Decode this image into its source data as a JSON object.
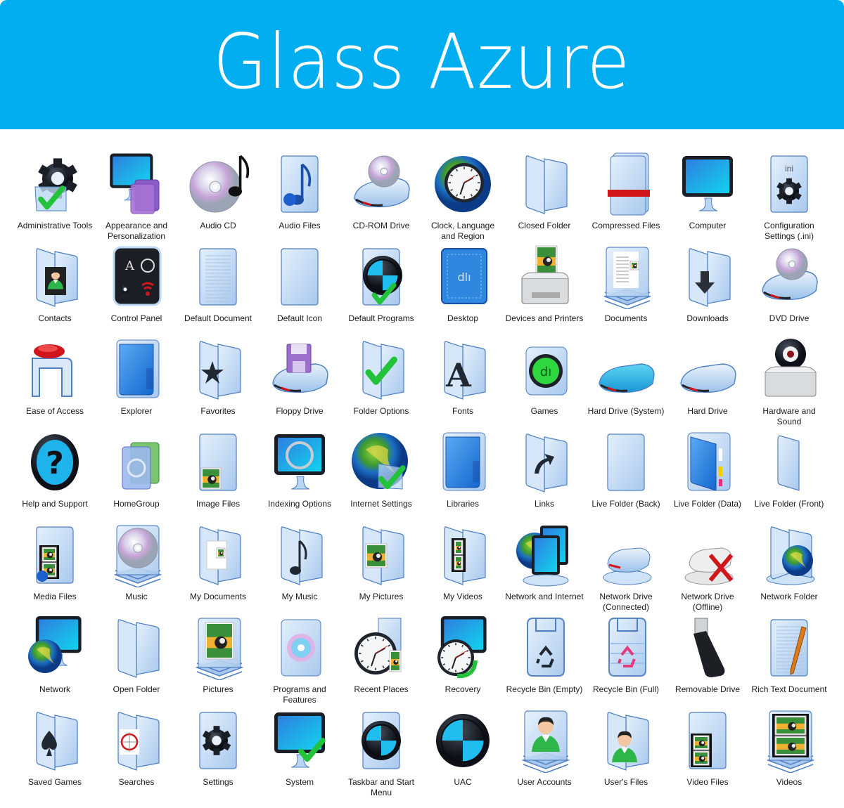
{
  "title": "Glass Azure",
  "colors": {
    "banner": "#00adef",
    "banner_text": "#ffffff",
    "glass": "#bcd8f4",
    "glass_edge": "#4d7fc4",
    "accent_blue": "#1fa3e6",
    "check_green": "#22c33a",
    "red": "#d0161b"
  },
  "icons": [
    {
      "label": "Administrative Tools",
      "kind": "gear-check"
    },
    {
      "label": "Appearance and Personalization",
      "kind": "monitor-palette"
    },
    {
      "label": "Audio CD",
      "kind": "cd-note"
    },
    {
      "label": "Audio Files",
      "kind": "doc-note"
    },
    {
      "label": "CD-ROM Drive",
      "kind": "drive-cd"
    },
    {
      "label": "Clock, Language and Region",
      "kind": "globe-clock"
    },
    {
      "label": "Closed Folder",
      "kind": "folder"
    },
    {
      "label": "Compressed Files",
      "kind": "zip"
    },
    {
      "label": "Computer",
      "kind": "monitor"
    },
    {
      "label": "Configuration Settings (.ini)",
      "kind": "doc-gear"
    },
    {
      "label": "Contacts",
      "kind": "folder-user"
    },
    {
      "label": "Control Panel",
      "kind": "control-panel"
    },
    {
      "label": "Default Document",
      "kind": "doc-lines"
    },
    {
      "label": "Default Icon",
      "kind": "doc"
    },
    {
      "label": "Default Programs",
      "kind": "doc-disc-check"
    },
    {
      "label": "Desktop",
      "kind": "desktop"
    },
    {
      "label": "Devices and Printers",
      "kind": "printer"
    },
    {
      "label": "Documents",
      "kind": "stack-doc"
    },
    {
      "label": "Downloads",
      "kind": "folder-arrow"
    },
    {
      "label": "DVD Drive",
      "kind": "drive-cd"
    },
    {
      "label": "Ease of Access",
      "kind": "ease"
    },
    {
      "label": "Explorer",
      "kind": "explorer"
    },
    {
      "label": "Favorites",
      "kind": "folder-star"
    },
    {
      "label": "Floppy Drive",
      "kind": "drive-floppy"
    },
    {
      "label": "Folder Options",
      "kind": "folder-check"
    },
    {
      "label": "Fonts",
      "kind": "folder-font"
    },
    {
      "label": "Games",
      "kind": "games"
    },
    {
      "label": "Hard Drive (System)",
      "kind": "hdd-system"
    },
    {
      "label": "Hard Drive",
      "kind": "hdd"
    },
    {
      "label": "Hardware and Sound",
      "kind": "speaker"
    },
    {
      "label": "Help and Support",
      "kind": "help"
    },
    {
      "label": "HomeGroup",
      "kind": "homegroup"
    },
    {
      "label": "Image Files",
      "kind": "doc-image"
    },
    {
      "label": "Indexing Options",
      "kind": "monitor-search"
    },
    {
      "label": "Internet Settings",
      "kind": "globe-check"
    },
    {
      "label": "Libraries",
      "kind": "explorer"
    },
    {
      "label": "Links",
      "kind": "folder-link"
    },
    {
      "label": "Live Folder (Back)",
      "kind": "doc"
    },
    {
      "label": "Live Folder (Data)",
      "kind": "explorer-data"
    },
    {
      "label": "Live Folder (Front)",
      "kind": "folder-front"
    },
    {
      "label": "Media Files",
      "kind": "doc-media"
    },
    {
      "label": "Music",
      "kind": "stack-cd"
    },
    {
      "label": "My Documents",
      "kind": "folder-doc"
    },
    {
      "label": "My Music",
      "kind": "folder-note"
    },
    {
      "label": "My Pictures",
      "kind": "folder-image"
    },
    {
      "label": "My Videos",
      "kind": "folder-film"
    },
    {
      "label": "Network and Internet",
      "kind": "network-internet"
    },
    {
      "label": "Network Drive (Connected)",
      "kind": "netdrive"
    },
    {
      "label": "Network Drive (Offline)",
      "kind": "netdrive-off"
    },
    {
      "label": "Network Folder",
      "kind": "folder-globe"
    },
    {
      "label": "Network",
      "kind": "monitor-globe"
    },
    {
      "label": "Open Folder",
      "kind": "folder"
    },
    {
      "label": "Pictures",
      "kind": "stack-image"
    },
    {
      "label": "Programs and Features",
      "kind": "programs"
    },
    {
      "label": "Recent Places",
      "kind": "clock"
    },
    {
      "label": "Recovery",
      "kind": "recovery"
    },
    {
      "label": "Recycle Bin (Empty)",
      "kind": "bin"
    },
    {
      "label": "Recycle Bin (Full)",
      "kind": "bin-full"
    },
    {
      "label": "Removable Drive",
      "kind": "usb"
    },
    {
      "label": "Rich Text Document",
      "kind": "doc-pencil"
    },
    {
      "label": "Saved Games",
      "kind": "folder-spade"
    },
    {
      "label": "Searches",
      "kind": "folder-search"
    },
    {
      "label": "Settings",
      "kind": "doc-gear2"
    },
    {
      "label": "System",
      "kind": "monitor-check"
    },
    {
      "label": "Taskbar and Start Menu",
      "kind": "doc-disc"
    },
    {
      "label": "UAC",
      "kind": "disc"
    },
    {
      "label": "User Accounts",
      "kind": "stack-user"
    },
    {
      "label": "User's Files",
      "kind": "folder-user2"
    },
    {
      "label": "Video Files",
      "kind": "doc-film"
    },
    {
      "label": "Videos",
      "kind": "stack-film"
    }
  ]
}
